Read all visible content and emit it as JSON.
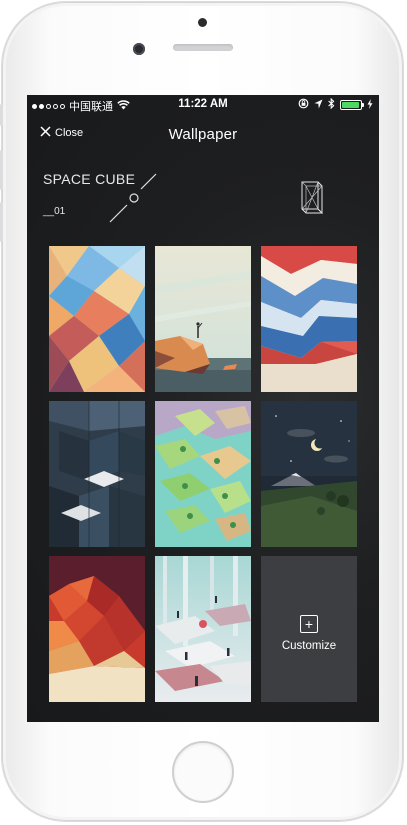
{
  "status_bar": {
    "carrier": "中国联通",
    "time": "11:22 AM",
    "battery_fill": 0.95,
    "battery_color": "#4cd964",
    "signal_dots_filled": 2,
    "signal_dots_total": 5,
    "icons": [
      "wifi-icon",
      "orientation-lock-icon",
      "location-icon",
      "bluetooth-icon",
      "battery-icon",
      "charging-icon"
    ]
  },
  "nav": {
    "close_label": "Close",
    "title": "Wallpaper"
  },
  "brand": {
    "name": "SPACE CUBE",
    "number": "__01"
  },
  "wallpapers": [
    {
      "id": "low-poly-pastel"
    },
    {
      "id": "rocky-seashore"
    },
    {
      "id": "red-blue-zigzag"
    },
    {
      "id": "isometric-cubes"
    },
    {
      "id": "floating-islands"
    },
    {
      "id": "night-mountain"
    },
    {
      "id": "red-mountain"
    },
    {
      "id": "forest-figures"
    }
  ],
  "customize": {
    "label": "Customize",
    "icon": "plus-icon"
  }
}
